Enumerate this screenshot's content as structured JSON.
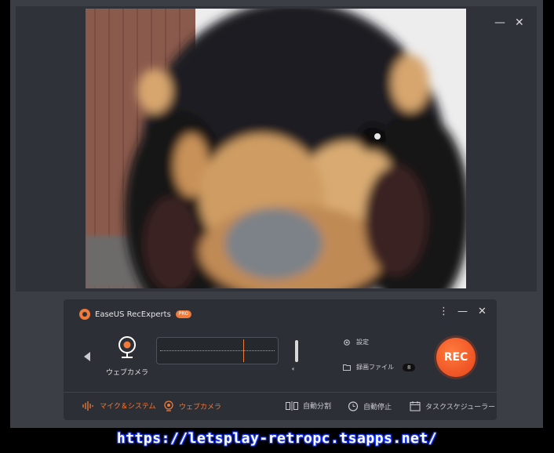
{
  "preview_window": {
    "minimize_glyph": "—",
    "close_glyph": "✕"
  },
  "panel": {
    "app_title": "EaseUS RecExperts",
    "pro_badge": "PRO",
    "more_glyph": "⋮",
    "minimize_glyph": "—",
    "close_glyph": "✕",
    "source_label": "ウェブカメラ",
    "settings_label": "設定",
    "recordings_label": "録画ファイル",
    "recordings_count": "8",
    "rec_label": "REC",
    "bottom": {
      "mic_system_label": "マイク＆システム",
      "webcam_label": "ウェブカメラ",
      "auto_split_label": "自動分割",
      "auto_stop_label": "自動停止",
      "scheduler_label": "タスクスケジューラー"
    }
  },
  "watermark_url": "https://letsplay-retropc.tsapps.net/",
  "colors": {
    "accent": "#f07a3a",
    "rec_button": "#e8431a",
    "panel_bg": "#2c2f35"
  }
}
